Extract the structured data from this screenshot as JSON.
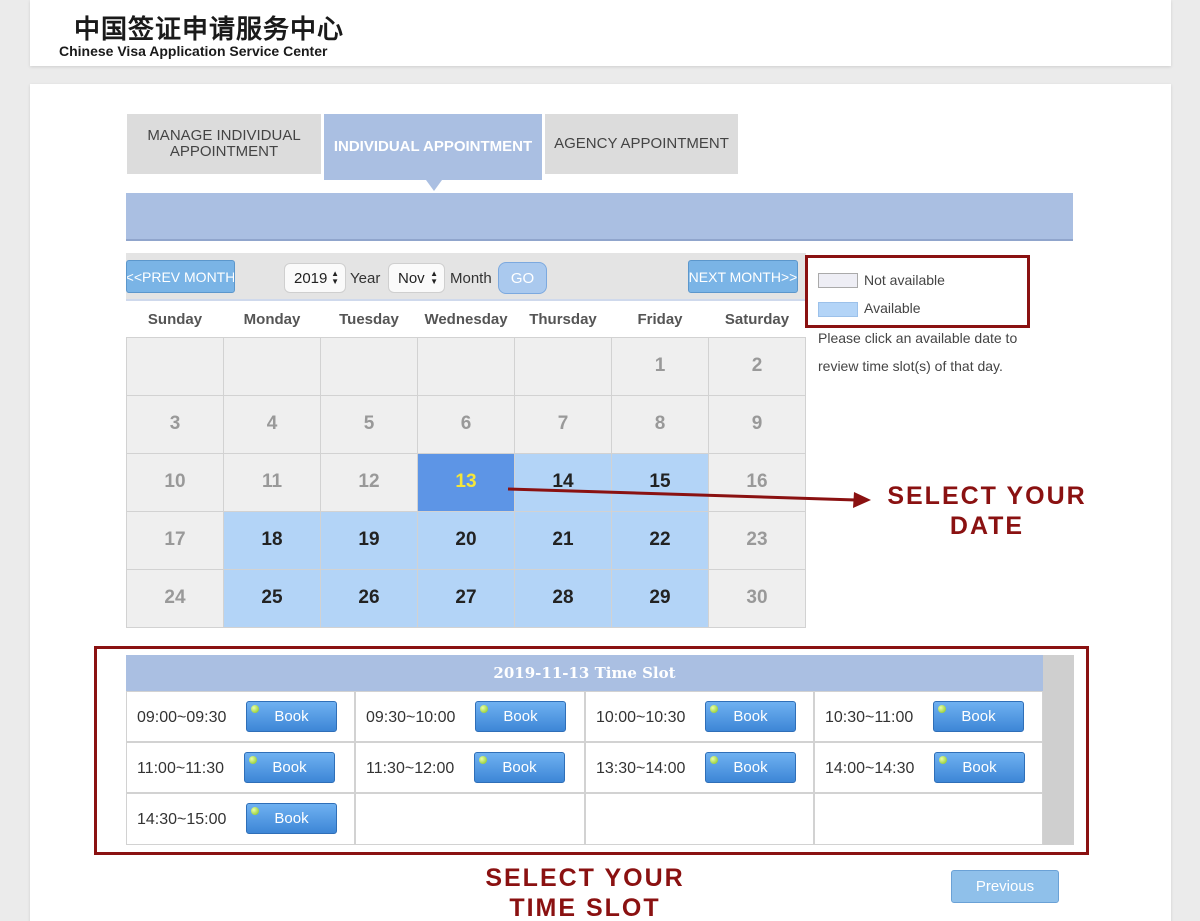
{
  "header": {
    "logo_cn": "中国签证申请服务中心",
    "logo_en": "Chinese Visa Application Service Center"
  },
  "tabs": [
    {
      "label": "MANAGE INDIVIDUAL APPOINTMENT",
      "active": false
    },
    {
      "label": "INDIVIDUAL APPOINTMENT",
      "active": true
    },
    {
      "label": "AGENCY APPOINTMENT",
      "active": false
    }
  ],
  "calendar_nav": {
    "prev_label": "<<PREV MONTH",
    "next_label": "NEXT MONTH>>",
    "year_value": "2019",
    "year_label": "Year",
    "month_value": "Nov",
    "month_label": "Month",
    "go_label": "GO"
  },
  "calendar": {
    "weekdays": [
      "Sunday",
      "Monday",
      "Tuesday",
      "Wednesday",
      "Thursday",
      "Friday",
      "Saturday"
    ],
    "weeks": [
      [
        "",
        "",
        "",
        "",
        "",
        "1",
        "2"
      ],
      [
        "3",
        "4",
        "5",
        "6",
        "7",
        "8",
        "9"
      ],
      [
        "10",
        "11",
        "12",
        "13",
        "14",
        "15",
        "16"
      ],
      [
        "17",
        "18",
        "19",
        "20",
        "21",
        "22",
        "23"
      ],
      [
        "24",
        "25",
        "26",
        "27",
        "28",
        "29",
        "30"
      ]
    ],
    "available_days": [
      "13",
      "14",
      "15",
      "18",
      "19",
      "20",
      "21",
      "22",
      "25",
      "26",
      "27",
      "28",
      "29"
    ],
    "selected_day": "13"
  },
  "legend": {
    "not_available": "Not available",
    "available": "Available",
    "note": "Please click an available date to review time slot(s) of that day."
  },
  "time_slots": {
    "title": "2019-11-13 Time Slot",
    "book_label": "Book",
    "slots": [
      "09:00~09:30",
      "09:30~10:00",
      "10:00~10:30",
      "10:30~11:00",
      "11:00~11:30",
      "11:30~12:00",
      "13:30~14:00",
      "14:00~14:30",
      "14:30~15:00"
    ]
  },
  "annotations": {
    "select_date_line1": "SELECT YOUR",
    "select_date_line2": "DATE",
    "select_slot_line1": "SELECT YOUR",
    "select_slot_line2": "TIME SLOT"
  },
  "footer": {
    "previous_label": "Previous"
  },
  "colors": {
    "tab_active": "#aabfe2",
    "available": "#b3d4f7",
    "selected": "#5d95e6",
    "annotation": "#8a1111"
  }
}
